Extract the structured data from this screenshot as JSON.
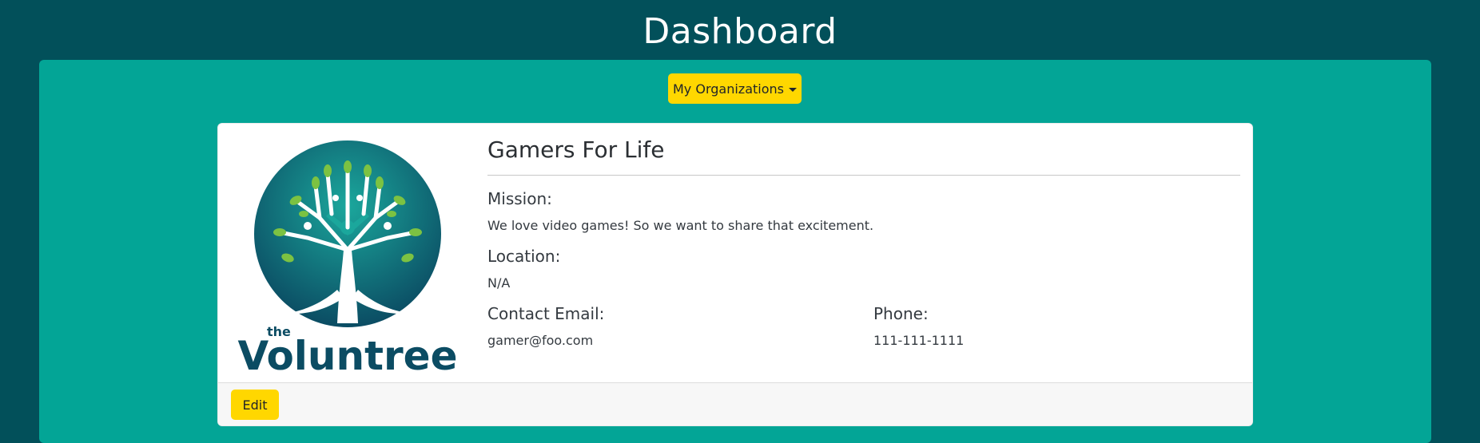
{
  "header": {
    "title": "Dashboard"
  },
  "toolbar": {
    "organizations_dropdown_label": "My Organizations"
  },
  "organization": {
    "name": "Gamers For Life",
    "logo_text_small": "the",
    "logo_text": "Voluntree",
    "mission_label": "Mission:",
    "mission": "We love video games! So we want to share that excitement.",
    "location_label": "Location:",
    "location": "N/A",
    "email_label": "Contact Email:",
    "email": "gamer@foo.com",
    "phone_label": "Phone:",
    "phone": "111-111-1111"
  },
  "footer": {
    "edit_label": "Edit"
  },
  "colors": {
    "page_background": "#02505a",
    "panel_background": "#03a596",
    "accent_yellow": "#ffd700",
    "logo_dark_teal": "#0b4c63",
    "logo_teal": "#15988f",
    "logo_green": "#7cc242"
  }
}
